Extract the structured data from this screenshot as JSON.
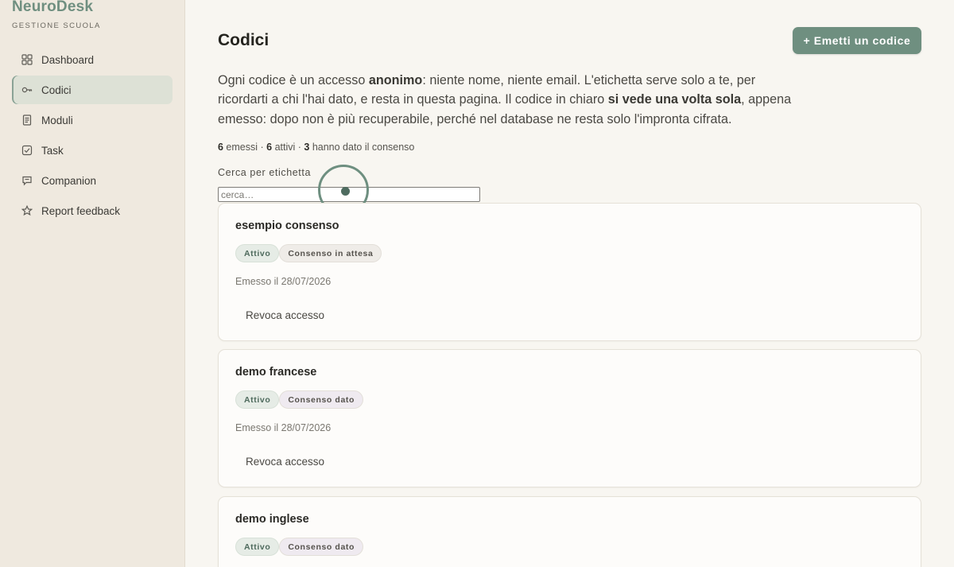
{
  "brand": {
    "name": "NeuroDesk",
    "subtitle": "GESTIONE SCUOLA"
  },
  "sidebar": {
    "items": [
      {
        "label": "Dashboard",
        "icon": "grid-icon",
        "active": false
      },
      {
        "label": "Codici",
        "icon": "key-icon",
        "active": true
      },
      {
        "label": "Moduli",
        "icon": "document-icon",
        "active": false
      },
      {
        "label": "Task",
        "icon": "checkbox-icon",
        "active": false
      },
      {
        "label": "Companion",
        "icon": "chat-icon",
        "active": false
      },
      {
        "label": "Report feedback",
        "icon": "star-icon",
        "active": false
      }
    ]
  },
  "header": {
    "title": "Codici",
    "primary_button": "+ Emetti un codice"
  },
  "intro": {
    "p1": "Ogni codice è un accesso ",
    "b1": "anonimo",
    "p2": ": niente nome, niente email. L'etichetta serve solo a te, per ricordarti a chi l'hai dato, e resta in questa pagina. Il codice in chiaro ",
    "b2": "si vede una volta sola",
    "p3": ", appena emesso: dopo non è più recuperabile, perché nel database ne resta solo l'impronta cifrata."
  },
  "stats": {
    "issued_count": "6",
    "issued_label": " emessi · ",
    "active_count": "6",
    "active_label": " attivi · ",
    "consent_count": "3",
    "consent_label": " hanno dato il consenso"
  },
  "search": {
    "label": "Cerca per etichetta",
    "placeholder": "cerca…",
    "value": ""
  },
  "colors": {
    "accent": "#6f8f80",
    "background": "#f8f6f1",
    "sidebar": "#efe9df"
  },
  "codes": [
    {
      "label": "esempio consenso",
      "status": "Attivo",
      "consent": "Consenso in attesa",
      "issued": "Emesso il 28/07/2026",
      "revoke": "Revoca accesso"
    },
    {
      "label": "demo francese",
      "status": "Attivo",
      "consent": "Consenso dato",
      "issued": "Emesso il 28/07/2026",
      "revoke": "Revoca accesso"
    },
    {
      "label": "demo inglese",
      "status": "Attivo",
      "consent": "Consenso dato",
      "issued": "",
      "revoke": ""
    }
  ]
}
